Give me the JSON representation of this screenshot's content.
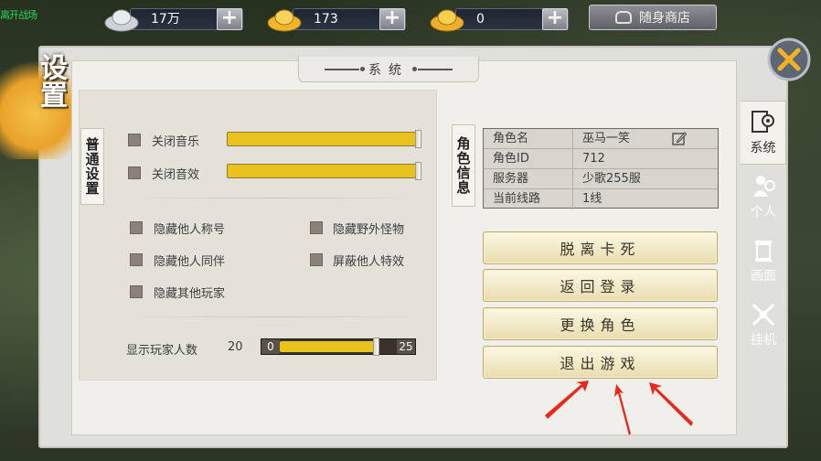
{
  "top_left_text": "离开战场",
  "currency": [
    {
      "name": "silver",
      "amount": "17万"
    },
    {
      "name": "gold-ingot",
      "amount": "173"
    },
    {
      "name": "gold-bar",
      "amount": "0"
    }
  ],
  "shop_button": "随身商店",
  "page_title": "设置",
  "header_tab": "系统",
  "general_settings": {
    "label": "普通设置",
    "mute_music": "关闭音乐",
    "mute_music_volume": 1.0,
    "mute_sfx": "关闭音效",
    "mute_sfx_volume": 1.0,
    "hide_titles": "隐藏他人称号",
    "hide_monsters": "隐藏野外怪物",
    "hide_companions": "隐藏他人同伴",
    "hide_effects": "屏蔽他人特效",
    "hide_players": "隐藏其他玩家",
    "player_count_label": "显示玩家人数",
    "player_count_value": "20",
    "range_min": "0",
    "range_max": "25"
  },
  "character_info": {
    "label": "角色信息",
    "rows": [
      {
        "key": "角色名",
        "value": "巫马一笑"
      },
      {
        "key": "角色ID",
        "value": "712"
      },
      {
        "key": "服务器",
        "value": "少歌255服"
      },
      {
        "key": "当前线路",
        "value": "1线"
      }
    ]
  },
  "actions": {
    "unstuck": "脱离卡死",
    "back_to_login": "返回登录",
    "switch_character": "更换角色",
    "exit_game": "退出游戏"
  },
  "side_tabs": [
    {
      "label": "系统",
      "icon": "gear-monitor-icon"
    },
    {
      "label": "个人",
      "icon": "person-gear-icon"
    },
    {
      "label": "画面",
      "icon": "screen-scroll-icon"
    },
    {
      "label": "挂机",
      "icon": "crossed-swords-icon"
    }
  ],
  "colors": {
    "slider": "#e8c21d",
    "arrow": "#e8281e",
    "accent": "#e9a22a"
  }
}
